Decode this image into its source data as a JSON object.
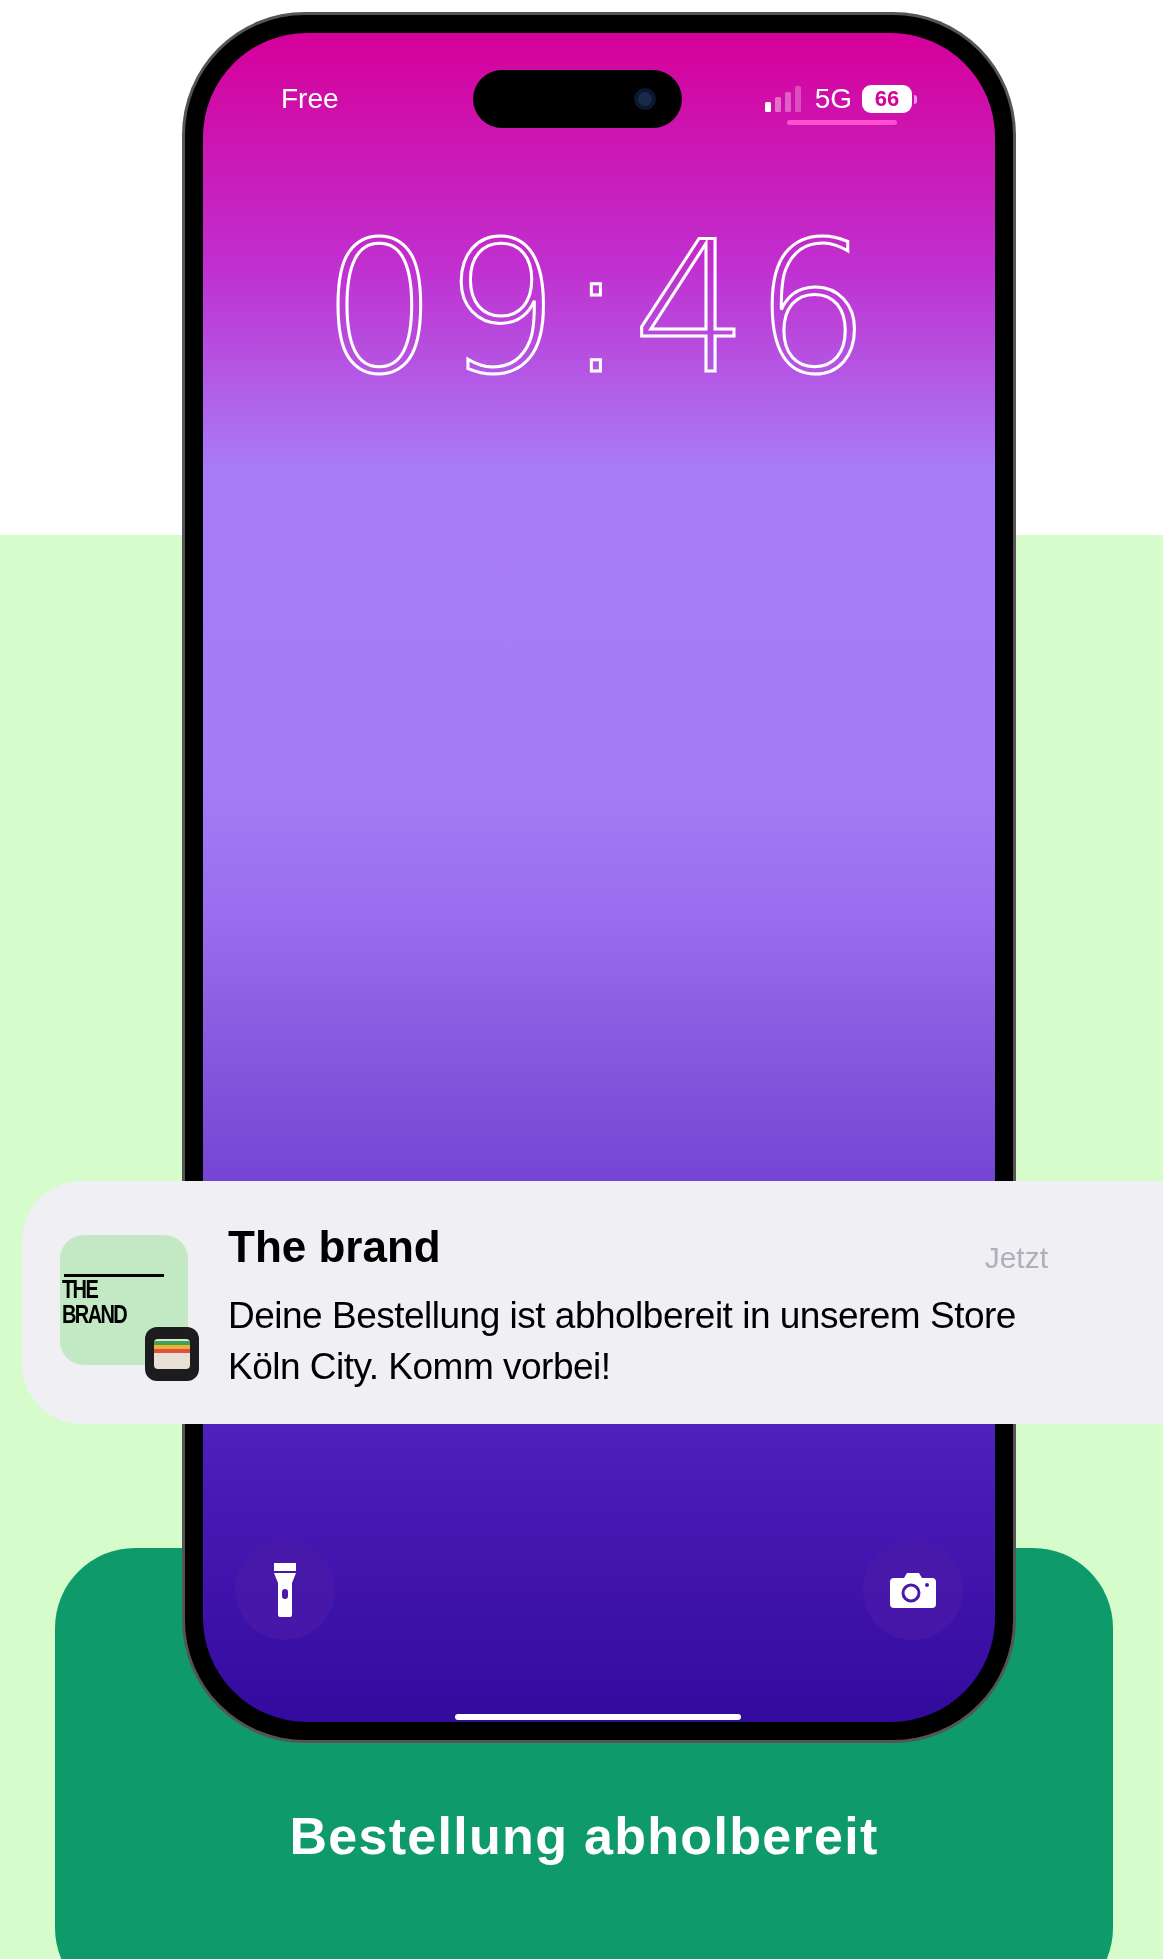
{
  "status_bar": {
    "carrier": "Free",
    "network": "5G",
    "battery": "66"
  },
  "lock_screen": {
    "time": "09:46"
  },
  "notification": {
    "app_icon_text": "THE BRAND",
    "title": "The brand",
    "time": "Jetzt",
    "message": "Deine Bestellung ist abholbereit in unserem Store Köln City. Komm vorbei!"
  },
  "caption": "Bestellung abholbereit"
}
